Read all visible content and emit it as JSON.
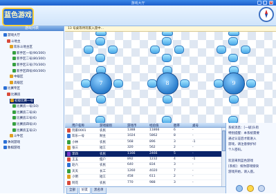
{
  "window": {
    "title": "游戏大厅"
  },
  "header": {
    "logo_text": "蓝色游戏"
  },
  "left_panel": {
    "title": "游戏列表",
    "tree": [
      {
        "label": "游戏大厅"
      },
      {
        "label": "斗地主"
      },
      {
        "label": "欢乐斗地主区"
      },
      {
        "label": "新手区一号(90/300)"
      },
      {
        "label": "新手区二号(80/300)"
      },
      {
        "label": "新手区三号(70/300)"
      },
      {
        "label": "新手区四号(60/300)"
      },
      {
        "label": "中级区"
      },
      {
        "label": "高级区"
      },
      {
        "label": "比赛专区"
      },
      {
        "label": "比赛房"
      },
      {
        "label": "初级比赛一号"
      },
      {
        "label": "比赛房一号(10)"
      },
      {
        "label": "比赛房二号(8)"
      },
      {
        "label": "比赛房三号(6)"
      },
      {
        "label": "比赛房四号(4)"
      },
      {
        "label": "比赛房五号(2)"
      },
      {
        "label": "斗牛区"
      },
      {
        "label": "休闲游戏"
      },
      {
        "label": "象棋游戏"
      }
    ]
  },
  "notice": "13 号桌等待玩家入座中...",
  "tables": [
    {
      "number": "7"
    },
    {
      "number": "8"
    },
    {
      "number": "9"
    }
  ],
  "player_list": {
    "columns": [
      "用户名称",
      "游戏级别",
      "游戏币",
      "经验值",
      "胜率",
      "桌号"
    ],
    "rows": [
      {
        "name": "玩家0001",
        "level": "农民",
        "coins": "1388",
        "exp": "11866",
        "rate": "6",
        "table": "-"
      },
      {
        "name": "欢乐一号",
        "level": "财主",
        "coins": "1024",
        "exp": "5862",
        "rate": "8",
        "table": "-"
      },
      {
        "name": "小林",
        "level": "农民",
        "coins": "568",
        "exp": "896",
        "rate": "3",
        "table": "-1"
      },
      {
        "name": "张三",
        "level": "短工",
        "coins": "320",
        "exp": "562",
        "rate": "2",
        "table": "-"
      },
      {
        "name": "李四",
        "level": "农民",
        "coins": "1166",
        "exp": "2466",
        "rate": "5",
        "table": "-"
      },
      {
        "name": "王五",
        "level": "佃户",
        "coins": "892",
        "exp": "1232",
        "rate": "4",
        "table": "-1"
      },
      {
        "name": "赵六",
        "level": "农民",
        "coins": "640",
        "exp": "834",
        "rate": "3",
        "table": "-"
      },
      {
        "name": "天天",
        "level": "长工",
        "coins": "1260",
        "exp": "4020",
        "rate": "7",
        "table": "-"
      },
      {
        "name": "小明",
        "level": "短工",
        "coins": "458",
        "exp": "611",
        "rate": "2",
        "table": "-"
      },
      {
        "name": "阿花",
        "level": "农民",
        "coins": "770",
        "exp": "988",
        "rate": "3",
        "table": "-"
      }
    ]
  },
  "tabs": [
    "全部",
    "好友",
    "黑名单"
  ],
  "chat": {
    "lines": [
      "系统消息：[一级]头衔",
      "特别提醒：本系统需要",
      "通过认证后才能进入",
      "游戏，请注意保护好",
      "个人密码。",
      "",
      "欢迎来到蓝色游戏",
      "[系统]：祝你游戏愉快",
      "游戏开始，请入座。"
    ]
  },
  "colors": {
    "accent": "#2a6fd6",
    "selection": "#0a246a",
    "logo_border": "#ffd23c"
  }
}
